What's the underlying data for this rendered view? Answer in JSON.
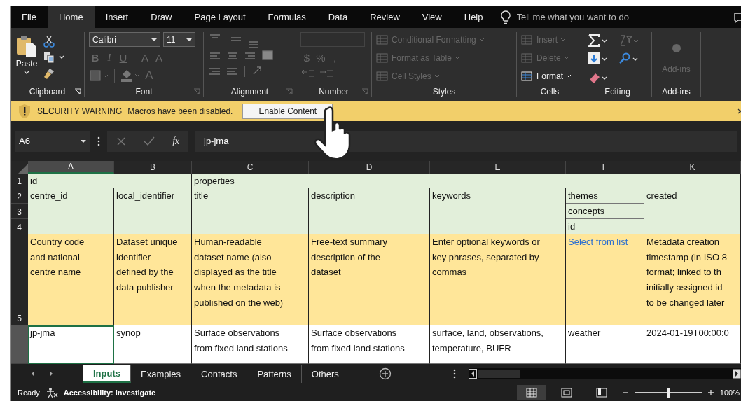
{
  "menu_tabs": [
    {
      "label": "File",
      "selected": false
    },
    {
      "label": "Home",
      "selected": true
    },
    {
      "label": "Insert",
      "selected": false
    },
    {
      "label": "Draw",
      "selected": false
    },
    {
      "label": "Page Layout",
      "selected": false
    },
    {
      "label": "Formulas",
      "selected": false
    },
    {
      "label": "Data",
      "selected": false
    },
    {
      "label": "Review",
      "selected": false
    },
    {
      "label": "View",
      "selected": false
    },
    {
      "label": "Help",
      "selected": false
    }
  ],
  "tell_me": {
    "placeholder": "Tell me what you want to do"
  },
  "ribbon": {
    "groups": [
      {
        "kind": "clipboard",
        "label": "Clipboard",
        "paste": "Paste"
      },
      {
        "kind": "font",
        "label": "Font",
        "font_name": "Calibri",
        "font_size": "11",
        "buttons": [
          {
            "label": "B",
            "disabled": true
          },
          {
            "label": "I",
            "disabled": true
          },
          {
            "label": "U",
            "disabled": true
          },
          {
            "label": "A",
            "disabled": true
          },
          {
            "label": "A",
            "disabled": true
          }
        ],
        "font_color": {
          "label": "A",
          "disabled": true
        }
      },
      {
        "kind": "alignment",
        "label": "Alignment"
      },
      {
        "kind": "number",
        "label": "Number",
        "buttons": [
          {
            "label": "$",
            "disabled": true
          },
          {
            "label": "%",
            "disabled": true
          },
          {
            "label": ",",
            "disabled": true
          }
        ]
      },
      {
        "kind": "styles",
        "label": "Styles",
        "items": [
          {
            "label": "Conditional Formatting",
            "disabled": true
          },
          {
            "label": "Format as Table",
            "disabled": true
          },
          {
            "label": "Cell Styles",
            "disabled": true
          }
        ]
      },
      {
        "kind": "cells",
        "label": "Cells",
        "items": [
          {
            "label": "Insert",
            "disabled": true
          },
          {
            "label": "Delete",
            "disabled": true
          },
          {
            "label": "Format",
            "disabled": false
          }
        ]
      },
      {
        "kind": "editing",
        "label": "Editing"
      },
      {
        "kind": "addins",
        "label": "Add-ins",
        "button": {
          "label": "Add-ins",
          "disabled": true
        }
      }
    ]
  },
  "security_bar": {
    "title": "SECURITY WARNING",
    "message": "Macros have been disabled.",
    "button": "Enable Content"
  },
  "formula_bar": {
    "name_box": "A6",
    "function_label": "fx",
    "value": "jp-jma"
  },
  "columns": [
    {
      "label": "A",
      "selected": true
    },
    {
      "label": "B",
      "selected": false
    },
    {
      "label": "C",
      "selected": false
    },
    {
      "label": "D",
      "selected": false
    },
    {
      "label": "E",
      "selected": false
    },
    {
      "label": "F",
      "selected": false
    },
    {
      "label": "K",
      "selected": false
    }
  ],
  "row_headers": [
    {
      "label": "1",
      "selected": false
    },
    {
      "label": "2",
      "selected": false
    },
    {
      "label": "3",
      "selected": false
    },
    {
      "label": "4",
      "selected": false
    },
    {
      "label": "5",
      "selected": false
    },
    {
      "selected": true
    }
  ],
  "group_headers": [
    {
      "text": "id"
    },
    {
      "text": "properties"
    }
  ],
  "field_headers": [
    {
      "kind": "single",
      "text": "centre_id"
    },
    {
      "kind": "single",
      "text": "local_identifier"
    },
    {
      "kind": "single",
      "text": "title"
    },
    {
      "kind": "single",
      "text": "description"
    },
    {
      "kind": "single",
      "text": "keywords"
    },
    {
      "kind": "nested",
      "parts": [
        "themes",
        "concepts",
        "id"
      ]
    },
    {
      "kind": "single",
      "text": "created"
    }
  ],
  "hints": [
    {
      "kind": "text",
      "text": "Country code\nand national\ncentre name"
    },
    {
      "kind": "text",
      "text": "Dataset unique\nidentifier\ndefined by the\ndata publisher"
    },
    {
      "kind": "text",
      "text": "Human-readable\ndataset name (also\ndisplayed as the title\nwhen the metadata is\npublished on the web)"
    },
    {
      "kind": "text",
      "text": "Free-text summary\ndescription of the\ndataset"
    },
    {
      "kind": "text",
      "text": "Enter optional keywords or\nkey phrases, separated by\ncommas"
    },
    {
      "kind": "link",
      "text": "Select from list"
    },
    {
      "kind": "text",
      "text": "Metadata creation\ntimestamp (in ISO 8\nformat; linked to th\ninitially assigned id\nto be changed later"
    }
  ],
  "data_row": [
    {
      "text": "jp-jma",
      "selected": true
    },
    {
      "text": "synop",
      "selected": false
    },
    {
      "text": "Surface observations\nfrom fixed land stations",
      "selected": false
    },
    {
      "text": "Surface observations\nfrom fixed land stations",
      "selected": false
    },
    {
      "text": "surface, land, observations,\ntemperature, BUFR",
      "selected": false
    },
    {
      "text": "weather",
      "selected": false
    },
    {
      "text": "2024-01-19T00:00:0",
      "selected": false
    }
  ],
  "sheet_tabs": [
    {
      "label": "Inputs",
      "selected": true
    },
    {
      "label": "Examples",
      "selected": false
    },
    {
      "label": "Contacts",
      "selected": false
    },
    {
      "label": "Patterns",
      "selected": false
    },
    {
      "label": "Others",
      "selected": false
    }
  ],
  "status_bar": {
    "status": "Ready",
    "accessibility": "Accessibility: Investigate",
    "views": [
      {
        "kind": "normal",
        "selected": true
      },
      {
        "kind": "page_layout",
        "selected": false
      },
      {
        "kind": "page_break",
        "selected": false
      }
    ],
    "zoom": {
      "level": 0.5,
      "label": "100%"
    }
  }
}
